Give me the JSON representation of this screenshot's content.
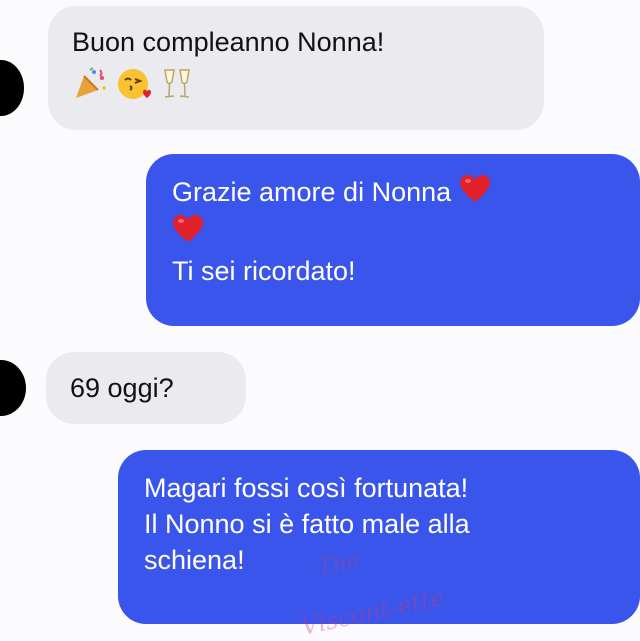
{
  "conversation": {
    "messages": [
      {
        "direction": "incoming",
        "lines": [
          "Buon compleanno Nonna!"
        ],
        "emojis": [
          "party-popper",
          "face-blowing-kiss",
          "clinking-glasses"
        ]
      },
      {
        "direction": "outgoing",
        "lines": [
          "Grazie amore di Nonna",
          "Ti sei ricordato!"
        ],
        "emojis": [
          "red-heart",
          "red-heart"
        ]
      },
      {
        "direction": "incoming",
        "lines": [
          "69 oggi?"
        ]
      },
      {
        "direction": "outgoing",
        "lines": [
          "Magari fossi così fortunata!",
          "Il Nonno si è fatto male alla",
          "schiena!"
        ]
      }
    ]
  },
  "watermark": {
    "line1": "The",
    "line2": "Viscont-ette"
  },
  "colors": {
    "incoming_bg": "#ebebef",
    "outgoing_bg": "#3a55ec",
    "outgoing_text": "#ffffff",
    "heart": "#e0202a"
  }
}
